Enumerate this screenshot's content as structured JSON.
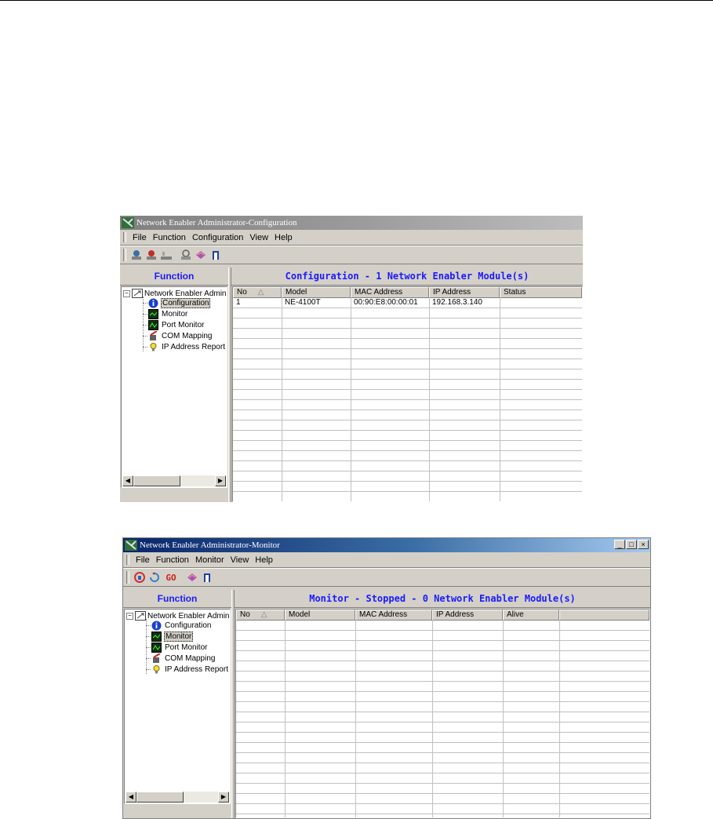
{
  "windows": [
    {
      "title": "Network Enabler Administrator-Configuration",
      "menu": [
        {
          "label": "File",
          "u": "F",
          "rest": "ile"
        },
        {
          "label": "Function",
          "u": "",
          "rest": "Function"
        },
        {
          "label": "Configuration",
          "u": "C",
          "rest": "onfiguration"
        },
        {
          "label": "View",
          "u": "",
          "rest": "View"
        },
        {
          "label": "Help",
          "u": "H",
          "rest": "elp"
        }
      ],
      "toolbar_icons": [
        "search-network-icon",
        "broadcast-search-icon",
        "unlock-icon",
        "locate-icon",
        "about-book-icon",
        "exit-icon"
      ],
      "left_header": "Function",
      "right_header": "Configuration - 1 Network Enabler Module(s)",
      "tree": {
        "root": "Network Enabler Admin",
        "items": [
          "Configuration",
          "Monitor",
          "Port Monitor",
          "COM Mapping",
          "IP Address Report"
        ],
        "selected": 0
      },
      "columns": [
        "No",
        "Model",
        "MAC Address",
        "IP Address",
        "Status"
      ],
      "rows": [
        [
          "1",
          "NE-4100T",
          "00:90:E8:00:00:01",
          "192.168.3.140",
          ""
        ]
      ]
    },
    {
      "title": "Network Enabler Administrator-Monitor",
      "menu": [
        {
          "label": "File",
          "u": "F",
          "rest": "ile"
        },
        {
          "label": "Function",
          "u": "",
          "rest": "Function"
        },
        {
          "label": "Monitor",
          "u": "",
          "rest": "Monitor"
        },
        {
          "label": "View",
          "u": "",
          "rest": "View"
        },
        {
          "label": "Help",
          "u": "H",
          "rest": "elp"
        }
      ],
      "toolbar_icons": [
        "start-monitor-icon",
        "stop-monitor-icon",
        "go-icon",
        "about-book-icon",
        "exit-icon"
      ],
      "toolbar_go_text": "GO",
      "left_header": "Function",
      "right_header": "Monitor - Stopped - 0 Network Enabler Module(s)",
      "tree": {
        "root": "Network Enabler Admin",
        "items": [
          "Configuration",
          "Monitor",
          "Port Monitor",
          "COM Mapping",
          "IP Address Report"
        ],
        "selected": 1
      },
      "columns": [
        "No",
        "Model",
        "MAC Address",
        "IP Address",
        "Alive"
      ],
      "rows": []
    }
  ]
}
